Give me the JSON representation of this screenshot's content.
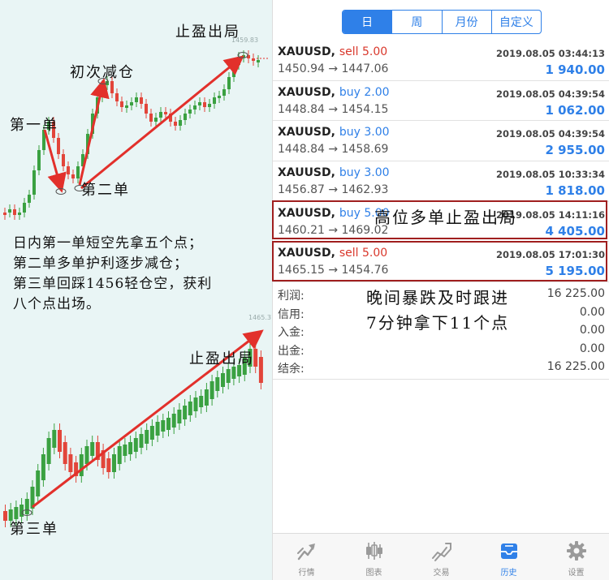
{
  "left": {
    "annotations": {
      "take_profit_top": "止盈出局",
      "first_reduce": "初次减仓",
      "first_order": "第一单",
      "second_order": "第二单",
      "take_profit_bottom": "止盈出局",
      "third_order": "第三单"
    },
    "price_tags": {
      "top_chart": "1459.83",
      "bottom_chart": "1465.31"
    },
    "summary_lines": [
      "日内第一单短空先拿五个点；",
      "第二单多单护利逐步减仓；",
      "第三单回踩1456轻仓空，获利",
      "八个点出场。"
    ]
  },
  "colors": {
    "bull_candle": "#3aa141",
    "bear_candle": "#e2453a",
    "arrow": "#e2302b",
    "accent": "#2f80e8",
    "sell": "#d9372b",
    "highlight_border": "#a01f1f"
  },
  "tabs": [
    {
      "label": "日",
      "active": true
    },
    {
      "label": "周",
      "active": false
    },
    {
      "label": "月份",
      "active": false
    },
    {
      "label": "自定义",
      "active": false
    }
  ],
  "trades": [
    {
      "symbol": "XAUUSD,",
      "side": "sell",
      "volume": "5.00",
      "prices": "1450.94 → 1447.06",
      "time": "2019.08.05 03:44:13",
      "profit": "1 940.00"
    },
    {
      "symbol": "XAUUSD,",
      "side": "buy",
      "volume": "2.00",
      "prices": "1448.84 → 1454.15",
      "time": "2019.08.05 04:39:54",
      "profit": "1 062.00"
    },
    {
      "symbol": "XAUUSD,",
      "side": "buy",
      "volume": "3.00",
      "prices": "1448.84 → 1458.69",
      "time": "2019.08.05 04:39:54",
      "profit": "2 955.00"
    },
    {
      "symbol": "XAUUSD,",
      "side": "buy",
      "volume": "3.00",
      "prices": "1456.87 → 1462.93",
      "time": "2019.08.05 10:33:34",
      "profit": "1 818.00"
    },
    {
      "symbol": "XAUUSD,",
      "side": "buy",
      "volume": "5.00",
      "prices": "1460.21 → 1469.02",
      "time": "2019.08.05 14:11:16",
      "profit": "4 405.00"
    },
    {
      "symbol": "XAUUSD,",
      "side": "sell",
      "volume": "5.00",
      "prices": "1465.15 → 1454.76",
      "time": "2019.08.05 17:01:30",
      "profit": "5 195.00"
    }
  ],
  "overlays": {
    "high_long": "高位多单止盈出局",
    "night_drop_line1": "晚间暴跌及时跟进",
    "night_drop_line2": "7分钟拿下11个点"
  },
  "summary": [
    {
      "label": "利润:",
      "value": "16 225.00"
    },
    {
      "label": "信用:",
      "value": "0.00"
    },
    {
      "label": "入金:",
      "value": "0.00"
    },
    {
      "label": "出金:",
      "value": "0.00"
    },
    {
      "label": "结余:",
      "value": "16 225.00"
    }
  ],
  "nav": [
    {
      "label": "行情",
      "icon": "trend-arrow-icon",
      "active": false
    },
    {
      "label": "图表",
      "icon": "candlestick-icon",
      "active": false
    },
    {
      "label": "交易",
      "icon": "trade-chart-icon",
      "active": false
    },
    {
      "label": "历史",
      "icon": "history-inbox-icon",
      "active": true
    },
    {
      "label": "设置",
      "icon": "gear-icon",
      "active": false
    }
  ]
}
